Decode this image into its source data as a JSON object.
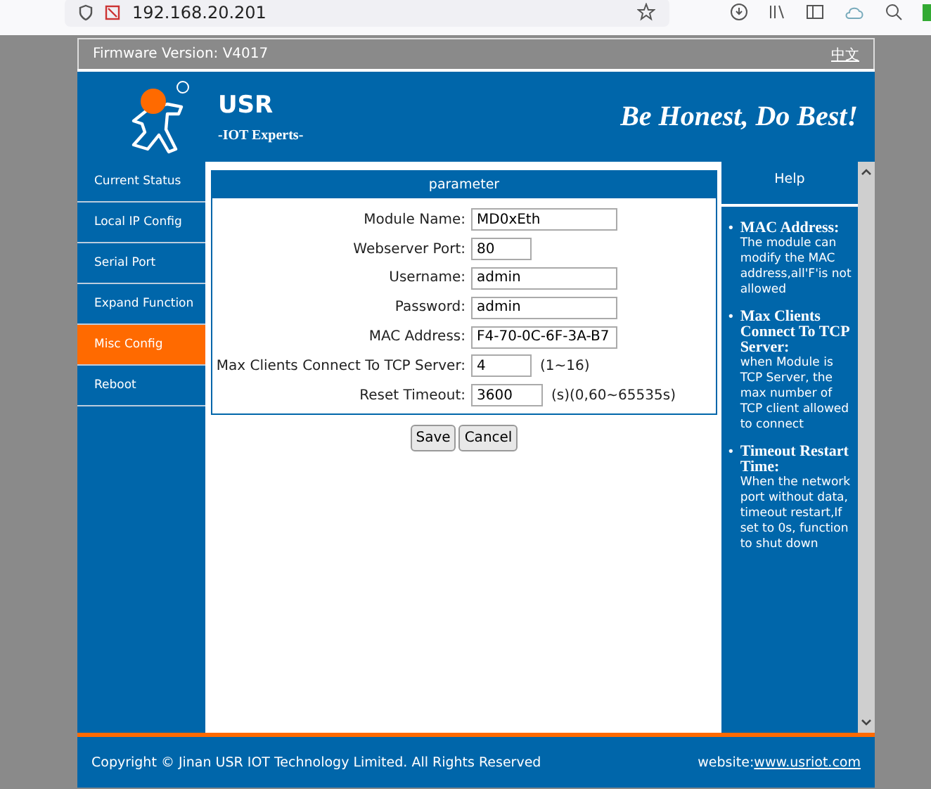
{
  "browser": {
    "url": "192.168.20.201"
  },
  "firmware": {
    "label": "Firmware Version:",
    "version": "V4017",
    "language": "中文"
  },
  "header": {
    "brand": "USR",
    "tagline": "-IOT Experts-",
    "slogan": "Be Honest, Do Best!"
  },
  "sidebar": {
    "items": [
      {
        "label": "Current Status",
        "selected": false
      },
      {
        "label": "Local IP Config",
        "selected": false
      },
      {
        "label": "Serial Port",
        "selected": false
      },
      {
        "label": "Expand Function",
        "selected": false
      },
      {
        "label": "Misc Config",
        "selected": true
      },
      {
        "label": "Reboot",
        "selected": false
      }
    ]
  },
  "panel": {
    "title": "parameter",
    "fields": [
      {
        "label": "Module Name:",
        "value": "MD0xEth"
      },
      {
        "label": "Webserver Port:",
        "value": "80"
      },
      {
        "label": "Username:",
        "value": "admin"
      },
      {
        "label": "Password:",
        "value": "admin"
      },
      {
        "label": "MAC Address:",
        "value": "F4-70-0C-6F-3A-B7"
      },
      {
        "label": "Max Clients Connect To TCP Server:",
        "value": "4",
        "hint": "(1~16)"
      },
      {
        "label": "Reset Timeout:",
        "value": "3600",
        "hint": "(s)(0,60~65535s)"
      }
    ]
  },
  "buttons": [
    "Save",
    "Cancel"
  ],
  "help": {
    "title": "Help",
    "items": [
      {
        "bullet": "•",
        "term": "MAC Address:",
        "text": "The module can modify the MAC address,all'F'is not allowed"
      },
      {
        "bullet": "•",
        "term": "Max Clients Connect To TCP Server:",
        "text": "when Module is TCP Server, the max number of TCP client allowed to connect"
      },
      {
        "bullet": "•",
        "term": "Timeout Restart Time:",
        "text": "When the network port without data, timeout restart,If set to 0s, function to shut down"
      }
    ]
  },
  "footer": {
    "copyright": "Copyright © Jinan USR IOT Technology Limited. All Rights Reserved",
    "website_label": "website:",
    "website": "www.usriot.com"
  }
}
